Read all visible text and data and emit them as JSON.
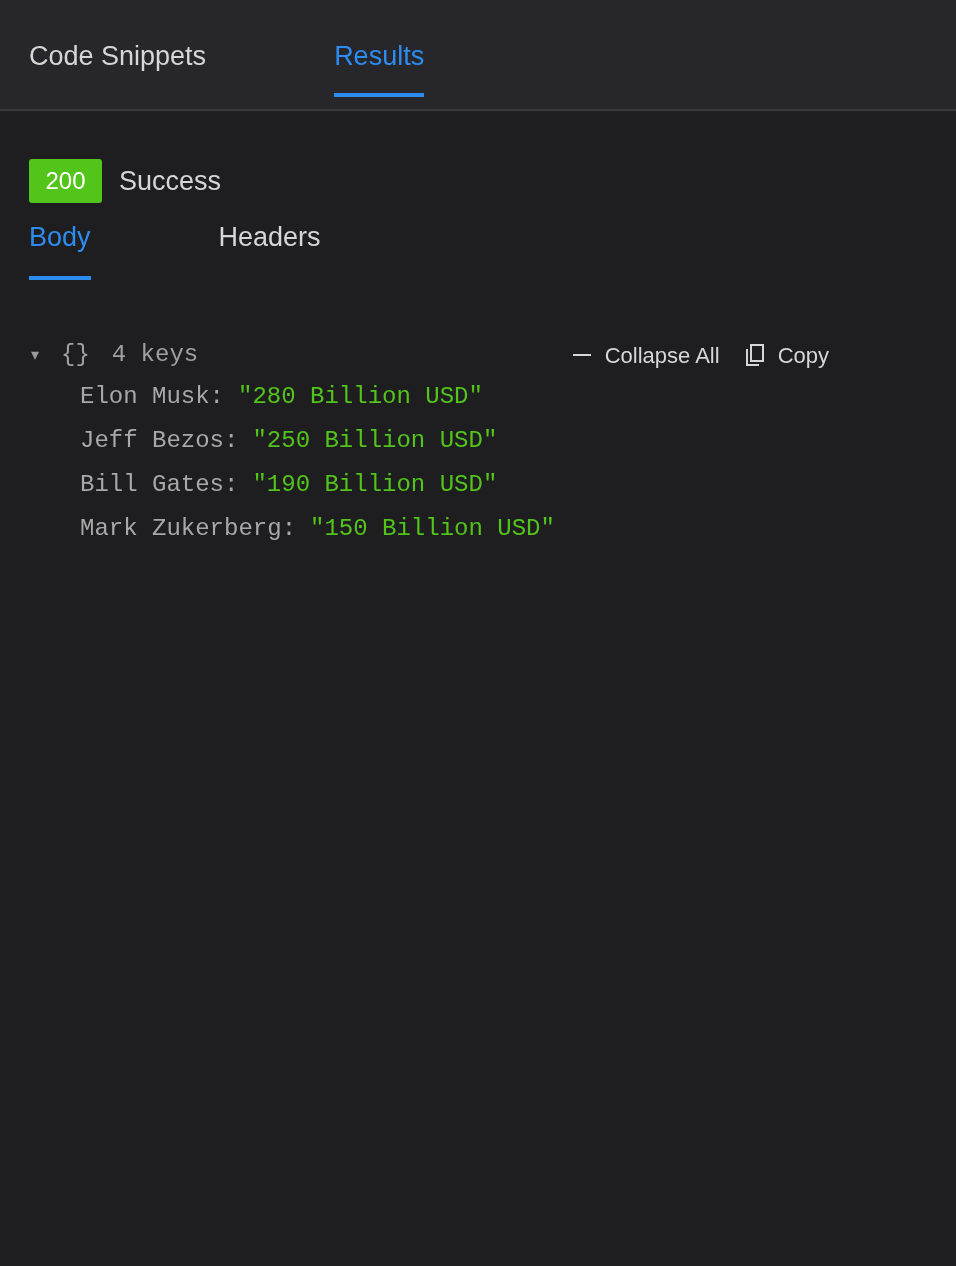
{
  "tabs": [
    {
      "label": "Code Snippets",
      "selected": false
    },
    {
      "label": "Results",
      "selected": true
    }
  ],
  "status": {
    "code": "200",
    "text": "Success"
  },
  "subtabs": [
    {
      "label": "Body",
      "selected": true
    },
    {
      "label": "Headers",
      "selected": false
    }
  ],
  "json_view": {
    "toggle": "▾",
    "expanded": true,
    "braces": "{}",
    "summary": "4 keys",
    "actions": [
      {
        "kind": "collapse",
        "label": "Collapse All"
      },
      {
        "kind": "copy",
        "label": "Copy"
      }
    ],
    "entries": [
      {
        "key": "Elon Musk:",
        "value": "\"280 Billion USD\""
      },
      {
        "key": "Jeff Bezos:",
        "value": "\"250 Billion USD\""
      },
      {
        "key": "Bill Gates:",
        "value": "\"190 Billion USD\""
      },
      {
        "key": "Mark Zukerberg:",
        "value": "\"150 Billion USD\""
      }
    ]
  }
}
